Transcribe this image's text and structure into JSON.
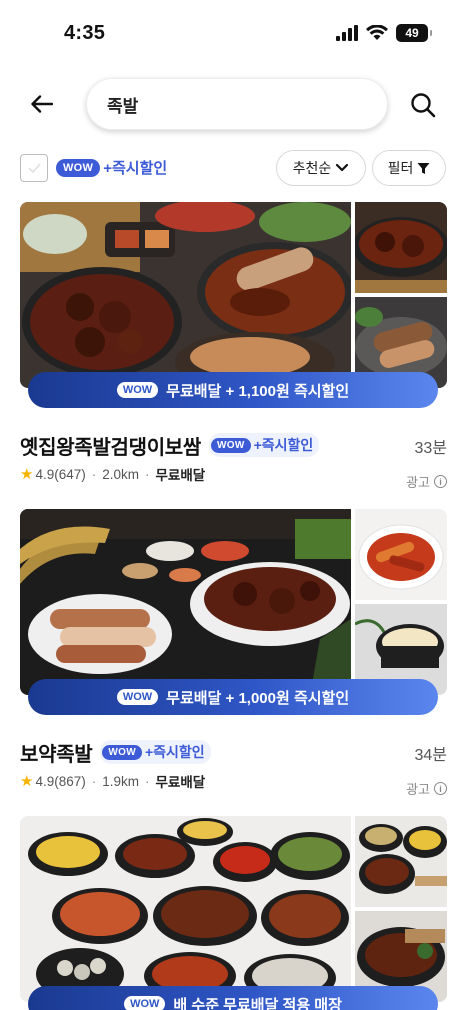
{
  "status_bar": {
    "time": "4:35",
    "battery": "49"
  },
  "search": {
    "query": "족발"
  },
  "filter_bar": {
    "wow_badge": "WOW",
    "wow_label": "+즉시할인",
    "sort_label": "추천순",
    "filter_label": "필터"
  },
  "stores": [
    {
      "name": "옛집왕족발검댕이보쌈",
      "wow_badge": "WOW",
      "wow_label": "+즉시할인",
      "eta": "33분",
      "rating": "4.9",
      "reviews": "(647)",
      "distance": "2.0km",
      "delivery": "무료배달",
      "ad_label": "광고",
      "promo_badge": "WOW",
      "promo_text": "무료배달 + 1,100원 즉시할인"
    },
    {
      "name": "보약족발",
      "wow_badge": "WOW",
      "wow_label": "+즉시할인",
      "eta": "34분",
      "rating": "4.9",
      "reviews": "(867)",
      "distance": "1.9km",
      "delivery": "무료배달",
      "ad_label": "광고",
      "promo_badge": "WOW",
      "promo_text": "무료배달 + 1,000원 즉시할인"
    },
    {
      "promo_badge": "WOW",
      "promo_text": "배 수준 무료배달 적용 매장"
    }
  ],
  "colors": {
    "wow_blue": "#3d5bd6",
    "star": "#f4b400",
    "promo_start": "#1a3990",
    "promo_end": "#5b86ee"
  }
}
